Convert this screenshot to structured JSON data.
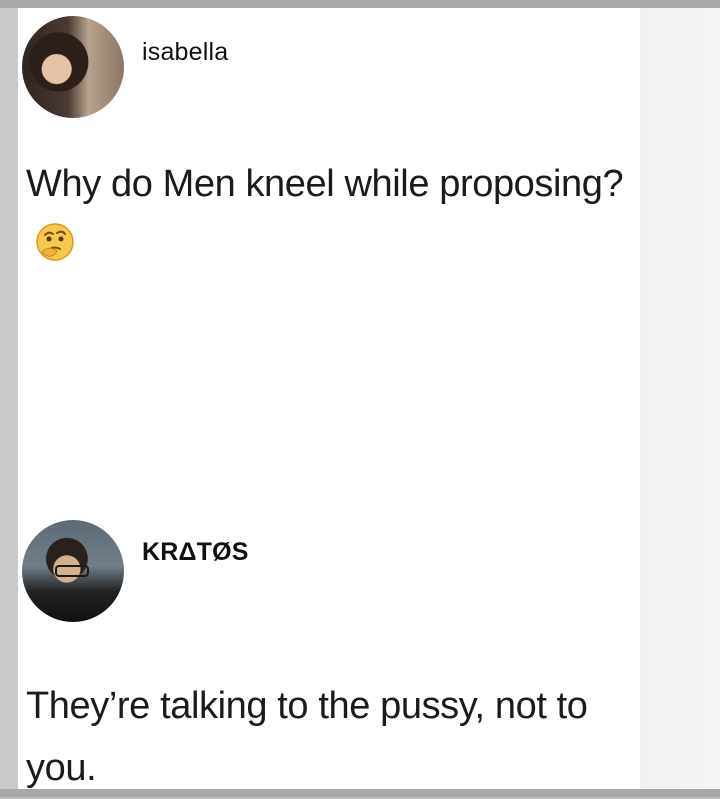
{
  "posts": [
    {
      "username": "isabella",
      "text": "Why do Men kneel while proposing?",
      "emoji_icon": "thinking-face-icon"
    },
    {
      "username": "KRΔTØS",
      "text": "They’re talking to the pussy, not to you."
    }
  ],
  "colors": {
    "background": "#ffffff",
    "text": "#111111",
    "frame": "#bdbdbd"
  }
}
